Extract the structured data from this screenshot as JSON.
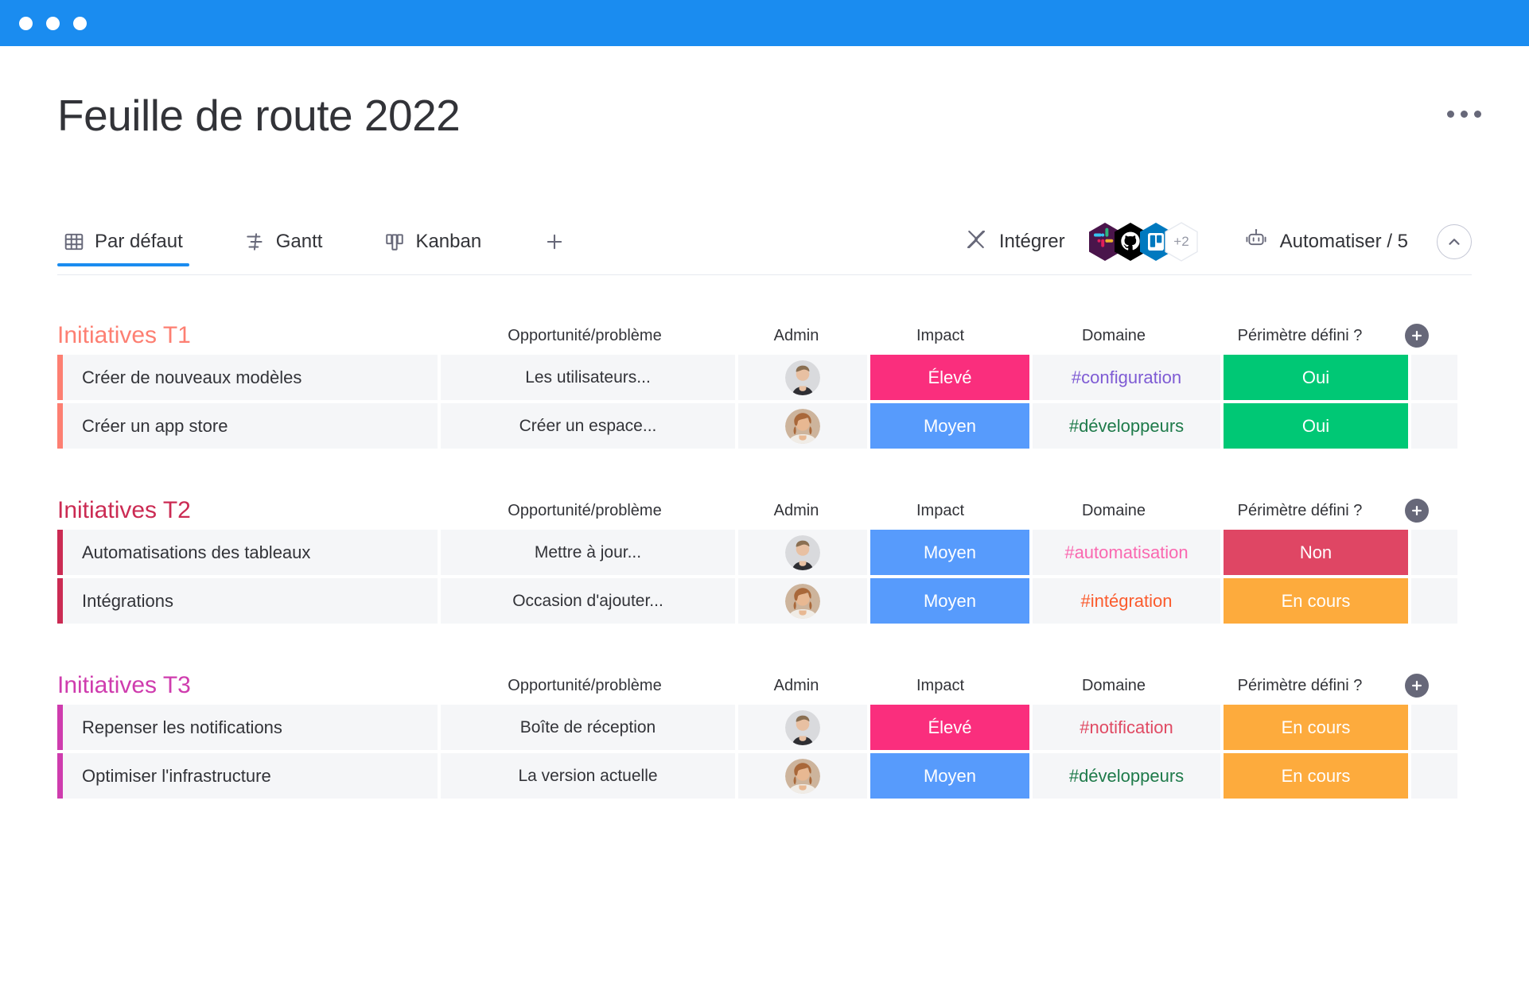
{
  "window": {
    "titlebar_color": "#1a8cf0",
    "dots": [
      "dot-1",
      "dot-2",
      "dot-3"
    ]
  },
  "header": {
    "title": "Feuille de route 2022",
    "more_label": "..."
  },
  "tabs": {
    "items": [
      {
        "label": "Par défaut",
        "icon": "grid-icon",
        "active": true
      },
      {
        "label": "Gantt",
        "icon": "gantt-icon",
        "active": false
      },
      {
        "label": "Kanban",
        "icon": "kanban-icon",
        "active": false
      }
    ],
    "add_label": "+",
    "integrate": {
      "label": "Intégrer",
      "icon": "integration-icon",
      "apps": [
        {
          "name": "slack-icon",
          "color": "#4a154b"
        },
        {
          "name": "github-icon",
          "color": "#000000"
        },
        {
          "name": "trello-icon",
          "color": "#0079bf"
        }
      ],
      "overflow_label": "+2"
    },
    "automate": {
      "label": "Automatiser / 5",
      "icon": "robot-icon"
    },
    "collapse_icon": "chevron-up-icon"
  },
  "columns": {
    "name": "",
    "opportunity": "Opportunité/problème",
    "admin": "Admin",
    "impact": "Impact",
    "domain": "Domaine",
    "scope": "Périmètre défini ?"
  },
  "colors": {
    "accent": "#1a8cf0",
    "impact_high": "#fa2e7d",
    "impact_medium": "#579bfc",
    "scope_yes": "#00c875",
    "scope_no": "#df4664",
    "scope_progress": "#fdab3d",
    "group_t1": "#fd7f72",
    "group_t2": "#cb2b53",
    "group_t3": "#cf3cae",
    "domain_configuration": "#7e5bd4",
    "domain_developpeurs": "#1e7a4a",
    "domain_automatisation": "#fa68b0",
    "domain_integration": "#fb5b2d",
    "domain_notification": "#e04a63",
    "row_bg": "#f5f6f8"
  },
  "groups": [
    {
      "title": "Initiatives T1",
      "color": "#fd7f72",
      "rows": [
        {
          "name": "Créer de nouveaux modèles",
          "opportunity": "Les utilisateurs...",
          "admin": "avatar-male",
          "impact": "Élevé",
          "impact_color": "#fa2e7d",
          "domain": "#configuration",
          "domain_color": "#7e5bd4",
          "scope": "Oui",
          "scope_color": "#00c875"
        },
        {
          "name": "Créer un app store",
          "opportunity": "Créer un espace...",
          "admin": "avatar-female",
          "impact": "Moyen",
          "impact_color": "#579bfc",
          "domain": "#développeurs",
          "domain_color": "#1e7a4a",
          "scope": "Oui",
          "scope_color": "#00c875"
        }
      ]
    },
    {
      "title": "Initiatives T2",
      "color": "#cb2b53",
      "rows": [
        {
          "name": "Automatisations des tableaux",
          "opportunity": "Mettre à jour...",
          "admin": "avatar-male",
          "impact": "Moyen",
          "impact_color": "#579bfc",
          "domain": "#automatisation",
          "domain_color": "#fa68b0",
          "scope": "Non",
          "scope_color": "#df4664"
        },
        {
          "name": "Intégrations",
          "opportunity": "Occasion d'ajouter...",
          "admin": "avatar-female",
          "impact": "Moyen",
          "impact_color": "#579bfc",
          "domain": "#intégration",
          "domain_color": "#fb5b2d",
          "scope": "En cours",
          "scope_color": "#fdab3d"
        }
      ]
    },
    {
      "title": "Initiatives T3",
      "color": "#cf3cae",
      "rows": [
        {
          "name": "Repenser les notifications",
          "opportunity": "Boîte de réception",
          "admin": "avatar-male",
          "impact": "Élevé",
          "impact_color": "#fa2e7d",
          "domain": "#notification",
          "domain_color": "#e04a63",
          "scope": "En cours",
          "scope_color": "#fdab3d"
        },
        {
          "name": "Optimiser l'infrastructure",
          "opportunity": "La version actuelle",
          "admin": "avatar-female",
          "impact": "Moyen",
          "impact_color": "#579bfc",
          "domain": "#développeurs",
          "domain_color": "#1e7a4a",
          "scope": "En cours",
          "scope_color": "#fdab3d"
        }
      ]
    }
  ]
}
